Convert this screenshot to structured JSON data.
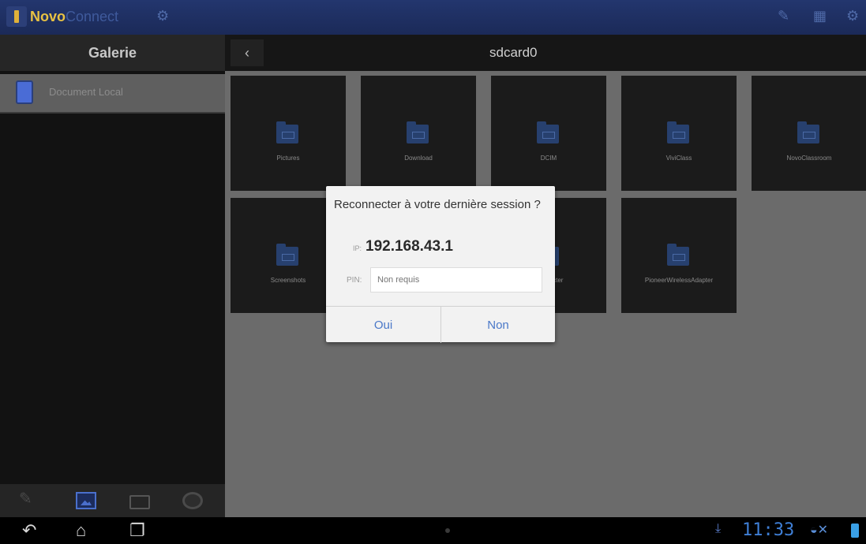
{
  "app": {
    "title_bold": "Novo",
    "title_rest": "Connect"
  },
  "nav": {
    "gallery_title": "Galerie",
    "back_symbol": "‹",
    "path_title": "sdcard0"
  },
  "left_panel": {
    "item_label": "Document Local"
  },
  "tiles": [
    {
      "label": "Pictures"
    },
    {
      "label": "Download"
    },
    {
      "label": "DCIM"
    },
    {
      "label": "ViviClass"
    },
    {
      "label": "NovoClassroom"
    },
    {
      "label": "Screenshots"
    },
    {
      "label": ""
    },
    {
      "label": "Connecter"
    },
    {
      "label": "PioneerWirelessAdapter"
    }
  ],
  "dialog": {
    "title": "Reconnecter à votre dernière session ?",
    "ip_label": "IP:",
    "ip_value": "192.168.43.1",
    "pin_label": "PIN:",
    "pin_placeholder": "Non requis",
    "yes_label": "Oui",
    "no_label": "Non"
  },
  "status_bar": {
    "time": "11:33"
  },
  "icons": [
    "app-icon",
    "settings-icon",
    "pen-icon",
    "grid-icon",
    "gear-icon",
    "folder-icon",
    "gallery-icon",
    "globe-icon",
    "back-icon",
    "home-icon",
    "recent-apps-icon",
    "download-icon",
    "wifi-icon",
    "battery-icon"
  ],
  "colors": {
    "accent": "#4a78c8",
    "title_bar": "#1b2a58",
    "clock": "#3f7fd6"
  }
}
